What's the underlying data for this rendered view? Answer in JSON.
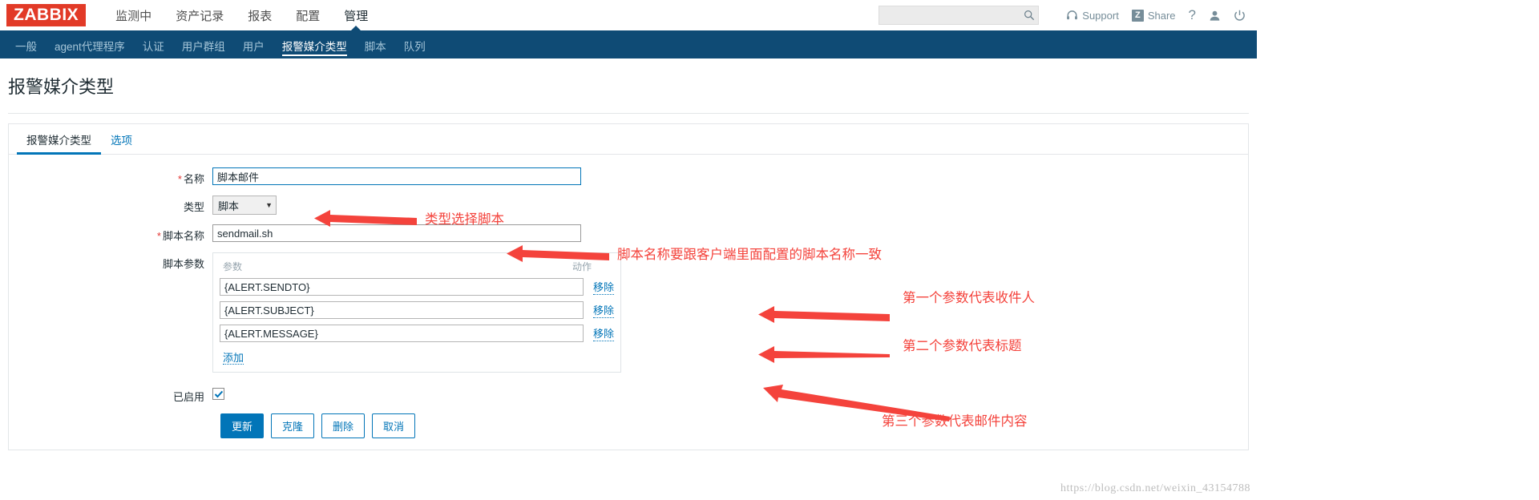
{
  "brand": {
    "logo": "ZABBIX",
    "logo_color": "#e23a27"
  },
  "topnav": {
    "items": [
      {
        "label": "监测中",
        "active": false
      },
      {
        "label": "资产记录",
        "active": false
      },
      {
        "label": "报表",
        "active": false
      },
      {
        "label": "配置",
        "active": false
      },
      {
        "label": "管理",
        "active": true
      }
    ]
  },
  "search": {
    "value": "",
    "placeholder": "",
    "icon": "search-icon"
  },
  "topright": {
    "support": {
      "label": "Support",
      "icon": "headset-icon"
    },
    "share": {
      "label": "Share",
      "badge": "Z",
      "icon": "share-icon"
    },
    "help": {
      "label": "?",
      "icon": "question-icon"
    },
    "user": {
      "icon": "user-icon"
    },
    "signout": {
      "icon": "power-icon"
    }
  },
  "subnav": {
    "items": [
      {
        "label": "一般",
        "active": false
      },
      {
        "label": "agent代理程序",
        "active": false
      },
      {
        "label": "认证",
        "active": false
      },
      {
        "label": "用户群组",
        "active": false
      },
      {
        "label": "用户",
        "active": false
      },
      {
        "label": "报警媒介类型",
        "active": true
      },
      {
        "label": "脚本",
        "active": false
      },
      {
        "label": "队列",
        "active": false
      }
    ]
  },
  "page": {
    "title": "报警媒介类型"
  },
  "tabs": [
    {
      "label": "报警媒介类型",
      "active": true
    },
    {
      "label": "选项",
      "active": false
    }
  ],
  "form": {
    "name": {
      "label": "名称",
      "required": true,
      "value": "脚本邮件"
    },
    "type": {
      "label": "类型",
      "required": false,
      "value": "脚本",
      "caret": "▼"
    },
    "script_name": {
      "label": "脚本名称",
      "required": true,
      "value": "sendmail.sh"
    },
    "script_params": {
      "label": "脚本参数",
      "col_param": "参数",
      "col_action": "动作",
      "remove_label": "移除",
      "add_label": "添加",
      "rows": [
        {
          "value": "{ALERT.SENDTO}"
        },
        {
          "value": "{ALERT.SUBJECT}"
        },
        {
          "value": "{ALERT.MESSAGE}"
        }
      ]
    },
    "enabled": {
      "label": "已启用",
      "checked": true
    }
  },
  "buttons": [
    {
      "label": "更新",
      "primary": true
    },
    {
      "label": "克隆",
      "primary": false
    },
    {
      "label": "删除",
      "primary": false
    },
    {
      "label": "取消",
      "primary": false
    }
  ],
  "annotations": {
    "a1": "类型选择脚本",
    "a2": "脚本名称要跟客户端里面配置的脚本名称一致",
    "a3": "第一个参数代表收件人",
    "a4": "第二个参数代表标题",
    "a5": "第三个参数代表邮件内容",
    "color": "#f4433c"
  },
  "watermark": "https://blog.csdn.net/weixin_43154788"
}
